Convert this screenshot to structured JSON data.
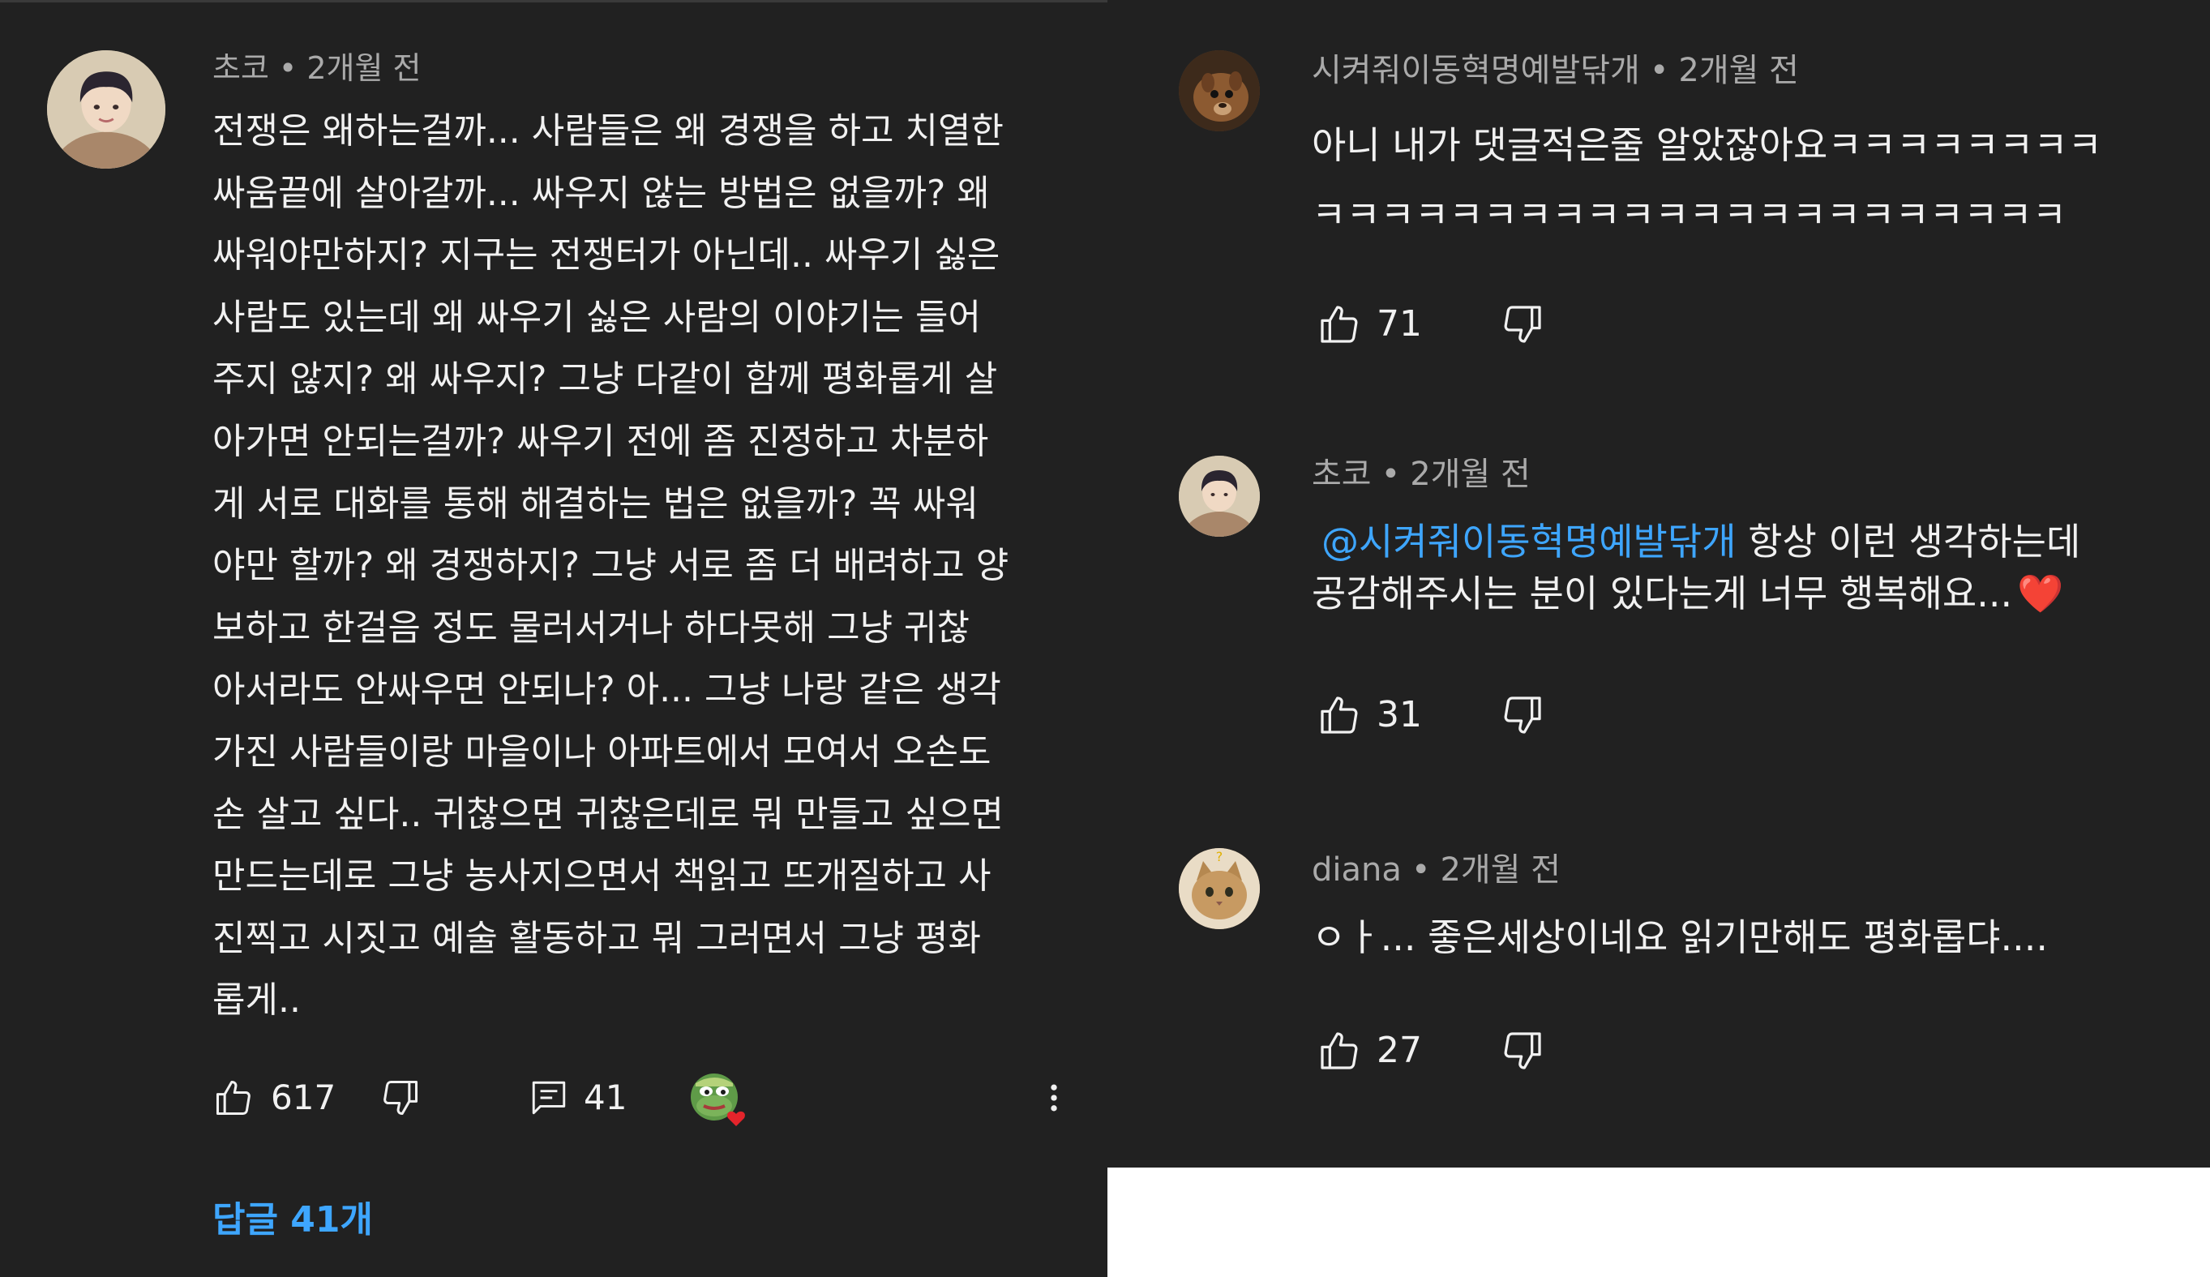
{
  "colors": {
    "background": "#212121",
    "text": "#f1f1f1",
    "meta": "#aaaaaa",
    "link": "#3ea6ff",
    "heart": "#e3242b"
  },
  "left": {
    "comment": {
      "author": "초코",
      "separator": "•",
      "time": "2개월 전",
      "lines": [
        "전쟁은 왜하는걸까... 사람들은 왜 경쟁을 하고 치열한",
        "싸움끝에 살아갈까... 싸우지 않는 방법은 없을까? 왜",
        "싸워야만하지? 지구는 전쟁터가 아닌데.. 싸우기 싫은",
        "사람도 있는데 왜 싸우기 싫은 사람의 이야기는 들어",
        "주지 않지? 왜 싸우지? 그냥 다같이 함께 평화롭게 살",
        "아가면 안되는걸까? 싸우기 전에 좀 진정하고 차분하",
        "게 서로 대화를 통해 해결하는 법은 없을까? 꼭 싸워",
        "야만 할까? 왜 경쟁하지? 그냥 서로 좀 더 배려하고 양",
        "보하고 한걸음 정도 물러서거나 하다못해 그냥 귀찮",
        "아서라도 안싸우면 안되나? 아... 그냥 나랑 같은 생각",
        "가진 사람들이랑 마을이나 아파트에서 모여서 오손도",
        "손 살고 싶다.. 귀찮으면 귀찮은데로 뭐 만들고 싶으면",
        "만드는데로 그냥 농사지으면서 책읽고 뜨개질하고 사",
        "진찍고 시짓고 예술 활동하고 뭐 그러면서 그냥 평화",
        "롭게.."
      ],
      "likes": "617",
      "reply_count": "41",
      "replies_link": "답글 41개"
    },
    "icons": {
      "like": "thumbs-up-icon",
      "dislike": "thumbs-down-icon",
      "reply": "comment-icon",
      "more": "more-vert-icon",
      "heart": "creator-heart-icon"
    }
  },
  "right": {
    "comments": [
      {
        "author": "시켜줘이동혁명예발닦개",
        "separator": "•",
        "time": "2개월 전",
        "lines": [
          "아니 내가 댓글적은줄 알았잖아요ㅋㅋㅋㅋㅋㅋㅋㅋ",
          "ㅋㅋㅋㅋㅋㅋㅋㅋㅋㅋㅋㅋㅋㅋㅋㅋㅋㅋㅋㅋㅋㅋ"
        ],
        "likes": "71"
      },
      {
        "author": "초코",
        "separator": "•",
        "time": "2개월 전",
        "mention": "@시켜줘이동혁명예발닦개",
        "line1_rest": " 항상 이런 생각하는데",
        "line2": "공감해주시는 분이 있다는게 너무 행복해요...",
        "emoji": "❤️",
        "likes": "31"
      },
      {
        "author": "diana",
        "separator": "•",
        "time": "2개월 전",
        "lines": [
          "ㅇㅏ... 좋은세상이네요 읽기만해도 평화롭댜...."
        ],
        "likes": "27"
      }
    ]
  }
}
